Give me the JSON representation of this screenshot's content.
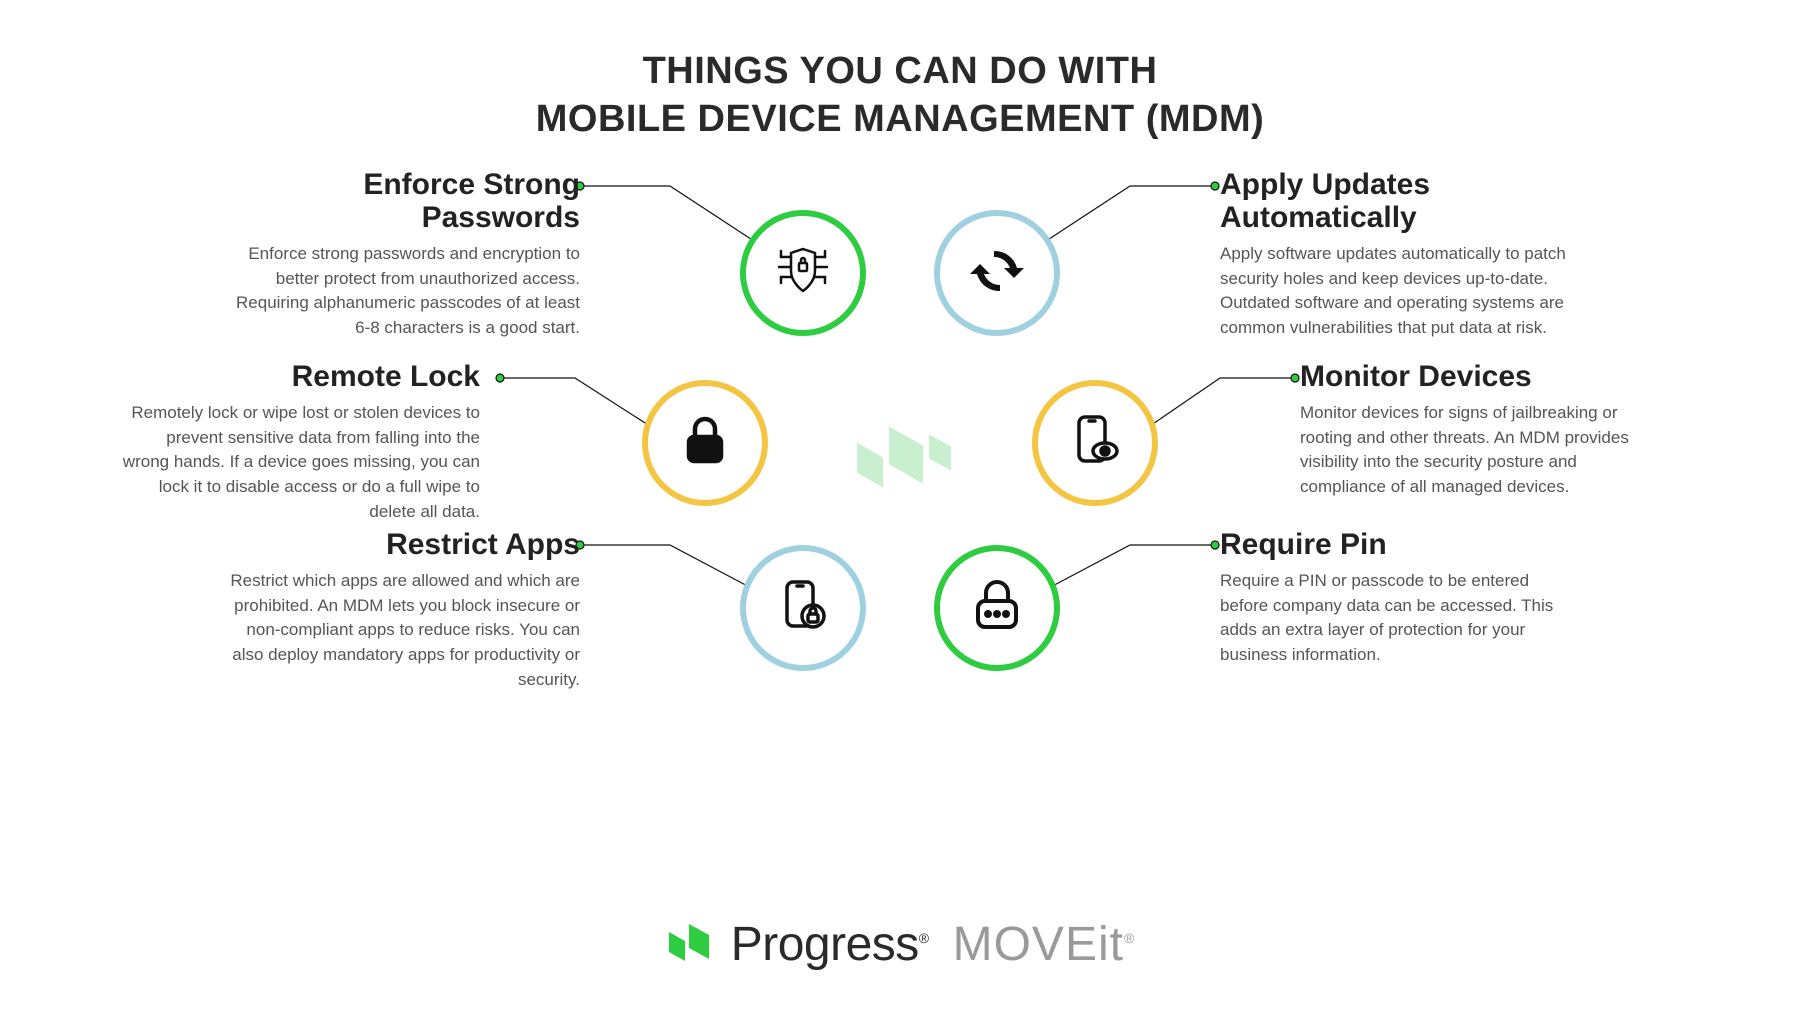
{
  "title_line1": "THINGS YOU CAN DO WITH",
  "title_line2": "MOBILE DEVICE MANAGEMENT (MDM)",
  "colors": {
    "green": "#2ecc40",
    "yellow": "#f4c542",
    "blue": "#9fd0e0"
  },
  "items": {
    "passwords": {
      "heading": "Enforce Strong Passwords",
      "body": "Enforce strong passwords and encryption to better protect from unauthorized access. Requiring alphanumeric passcodes of at least 6-8 characters is a good start."
    },
    "updates": {
      "heading": "Apply Updates Automatically",
      "body": "Apply software updates automatically to patch security holes and keep devices up-to-date. Outdated software and operating systems are common vulnerabilities that put data at risk."
    },
    "remote_lock": {
      "heading": "Remote Lock",
      "body": "Remotely lock or wipe lost or stolen devices to prevent sensitive data from falling into the wrong hands. If a device goes missing, you can lock it to disable access or do a full wipe to delete all data."
    },
    "monitor": {
      "heading": "Monitor Devices",
      "body": "Monitor devices for signs of jailbreaking or rooting and other threats. An MDM provides visibility into the security posture and compliance of all managed devices."
    },
    "restrict": {
      "heading": "Restrict Apps",
      "body": "Restrict which apps are allowed and which are prohibited. An MDM lets you block insecure or non-compliant apps to reduce risks. You can also deploy mandatory apps for productivity or security."
    },
    "require_pin": {
      "heading": "Require Pin",
      "body": "Require a PIN or passcode to be entered before company data can be accessed. This adds an extra layer of protection for your business information."
    }
  },
  "footer": {
    "brand1": "Progress",
    "brand2": "MOVEit"
  }
}
